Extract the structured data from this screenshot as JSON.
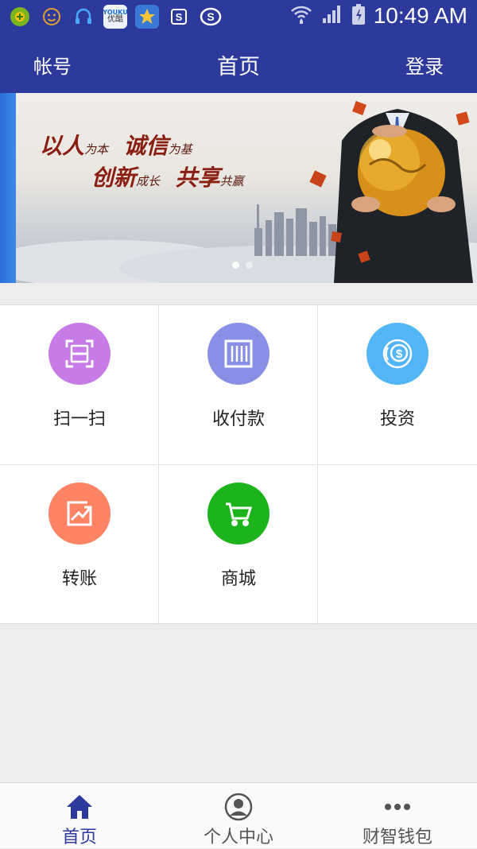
{
  "status_bar": {
    "time": "10:49 AM",
    "app_icons": [
      "app-icon-clover",
      "app-icon-face",
      "app-icon-headset",
      "app-icon-youku",
      "app-icon-star",
      "app-icon-s-square",
      "app-icon-s-logo"
    ],
    "youku_text": "YOUKU",
    "youku_cn": "优酷"
  },
  "header": {
    "left_label": "帐号",
    "title": "首页",
    "right_label": "登录"
  },
  "banner": {
    "slogan_line1_a": "以人",
    "slogan_line1_a_small": "为本",
    "slogan_line1_b": "诚信",
    "slogan_line1_b_small": "为基",
    "slogan_line2_a": "创新",
    "slogan_line2_a_small": "成长",
    "slogan_line2_b": "共享",
    "slogan_line2_b_small": "共赢",
    "slide_count": 2,
    "active_slide": 1
  },
  "grid": {
    "items": [
      {
        "label": "扫一扫",
        "icon": "scan-icon",
        "color": "#c77be6"
      },
      {
        "label": "收付款",
        "icon": "barcode-icon",
        "color": "#8a8fe6"
      },
      {
        "label": "投资",
        "icon": "dollar-coin-icon",
        "color": "#52b6f6"
      },
      {
        "label": "转账",
        "icon": "trend-chart-icon",
        "color": "#ff8466"
      },
      {
        "label": "商城",
        "icon": "cart-icon",
        "color": "#1db31d"
      }
    ]
  },
  "bottom_nav": {
    "items": [
      {
        "label": "首页",
        "icon": "home-icon",
        "active": true
      },
      {
        "label": "个人中心",
        "icon": "person-icon",
        "active": false
      },
      {
        "label": "财智钱包",
        "icon": "more-dots-icon",
        "active": false
      }
    ]
  },
  "colors": {
    "primary": "#2d3a9c",
    "background": "#ededed"
  }
}
